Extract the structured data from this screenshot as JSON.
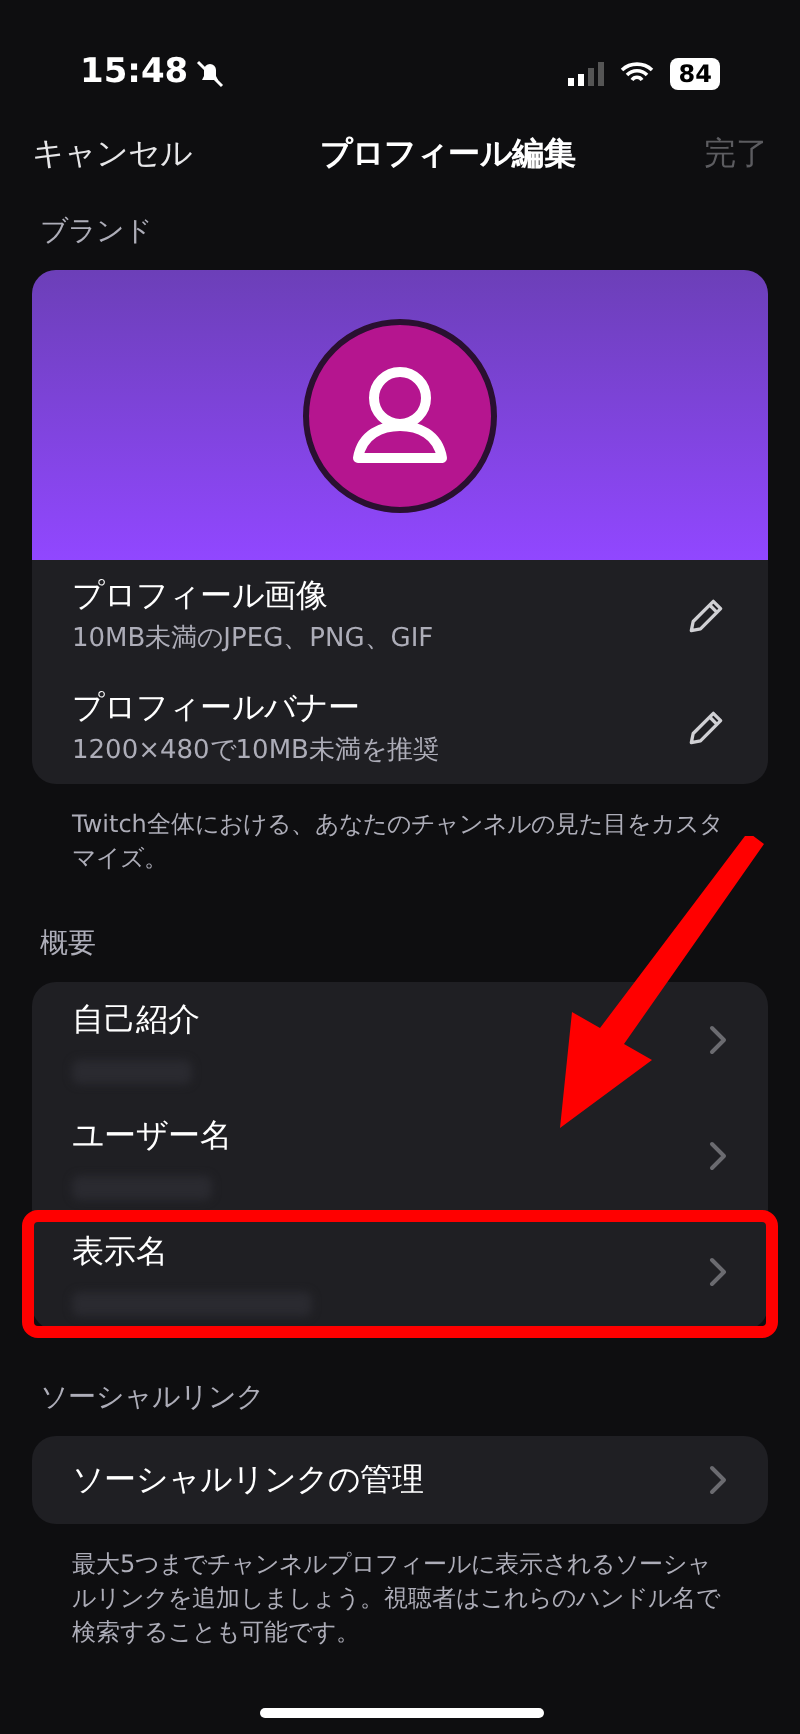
{
  "status_bar": {
    "time": "15:48",
    "battery": "84"
  },
  "nav": {
    "cancel": "キャンセル",
    "title": "プロフィール編集",
    "done": "完了",
    "done_disabled": true
  },
  "brand": {
    "heading": "ブランド",
    "rows": [
      {
        "title": "プロフィール画像",
        "subtitle": "10MB未満のJPEG、PNG、GIF"
      },
      {
        "title": "プロフィールバナー",
        "subtitle": "1200×480で10MB未満を推奨"
      }
    ],
    "note": "Twitch全体における、あなたのチャンネルの見た目をカスタマイズ。"
  },
  "overview": {
    "heading": "概要",
    "rows": [
      {
        "title": "自己紹介",
        "highlighted": false
      },
      {
        "title": "ユーザー名",
        "highlighted": false
      },
      {
        "title": "表示名",
        "highlighted": true
      }
    ]
  },
  "social": {
    "heading": "ソーシャルリンク",
    "row": "ソーシャルリンクの管理",
    "note": "最大5つまでチャンネルプロフィールに表示されるソーシャルリンクを追加しましょう。視聴者はこれらのハンドル名で検索することも可能です。"
  }
}
